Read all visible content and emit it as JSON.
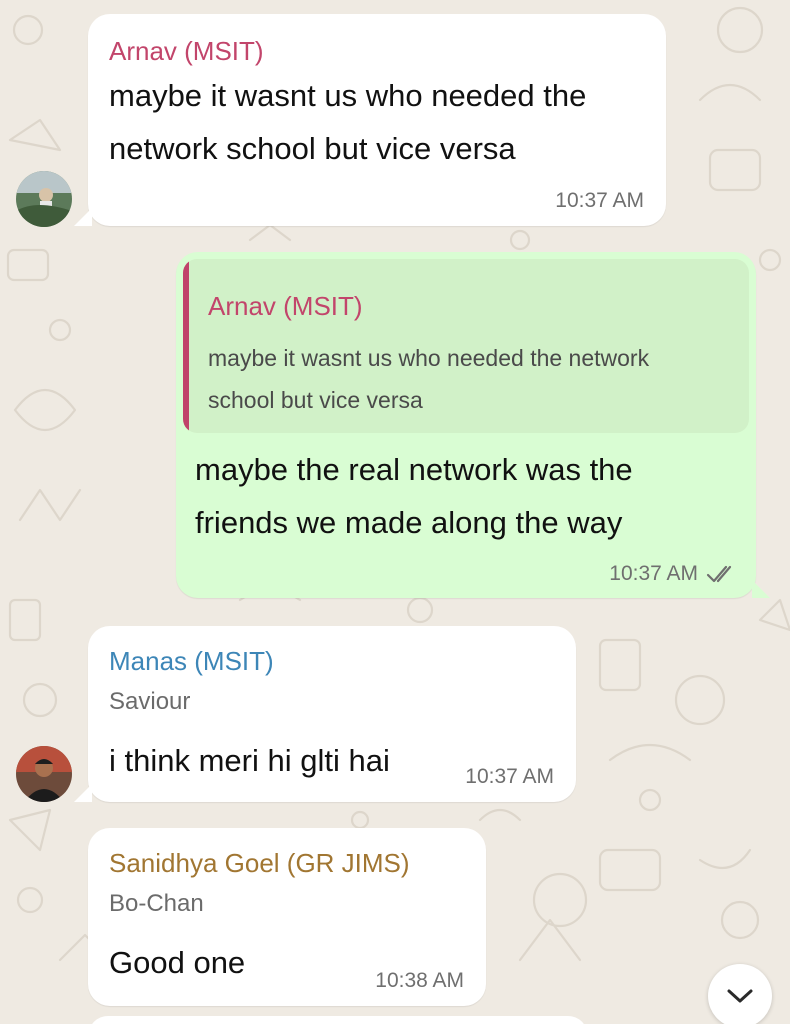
{
  "colors": {
    "background": "#efeae2",
    "incoming_bubble": "#ffffff",
    "outgoing_bubble": "#d9fdd3",
    "quote_bar": "#c0436a"
  },
  "messages": [
    {
      "sender": "Arnav (MSIT)",
      "sender_color": "#c2456b",
      "text": "maybe it wasnt us who needed the\nnetwork school but vice versa",
      "time": "10:37 AM"
    },
    {
      "quote": {
        "sender": "Arnav (MSIT)",
        "sender_color": "#c2456b",
        "text": "maybe it wasnt us who needed the network\nschool but vice versa"
      },
      "text": "maybe the real network was the\nfriends we made along the way",
      "time": "10:37 AM",
      "status_icon": "double-check-icon"
    },
    {
      "sender": "Manas (MSIT)",
      "sender_color": "#3d86b7",
      "subtitle": "Saviour",
      "text": "i think meri hi glti hai",
      "time": "10:37 AM"
    },
    {
      "sender": "Sanidhya Goel (GR JIMS)",
      "sender_color": "#a17632",
      "subtitle": "Bo-Chan",
      "text": "Good one",
      "time": "10:38 AM"
    }
  ],
  "scroll_button_icon": "chevron-down-icon"
}
